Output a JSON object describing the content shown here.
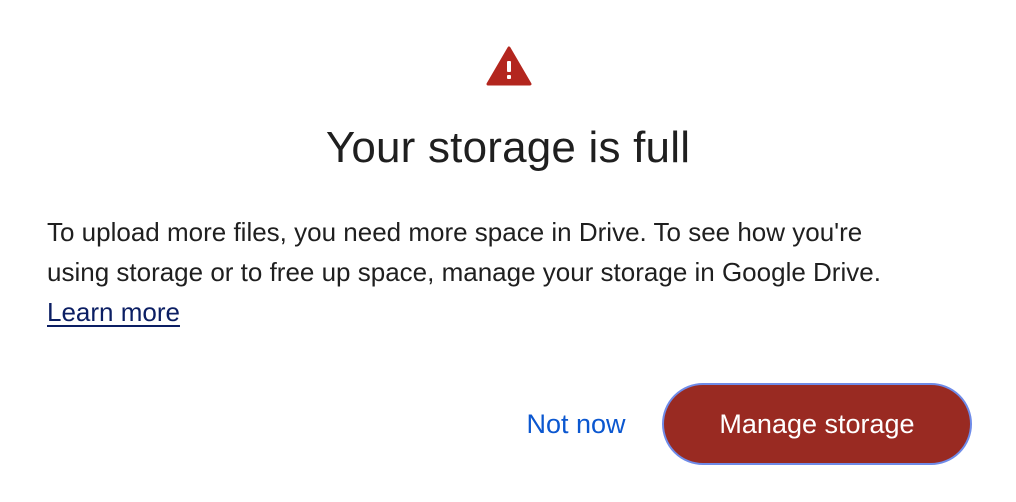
{
  "dialog": {
    "icon": "warning-triangle-icon",
    "icon_color": "#b3261e",
    "title": "Your storage is full",
    "body_line_1": "To upload more files, you need more space in Drive. To see how you're",
    "body_line_2": "using storage or to free up space, manage your storage in Google Drive.",
    "learn_more_label": "Learn more",
    "secondary_button_label": "Not now",
    "primary_button_label": "Manage storage",
    "primary_button_color": "#992a22",
    "link_color": "#0b57d0"
  }
}
